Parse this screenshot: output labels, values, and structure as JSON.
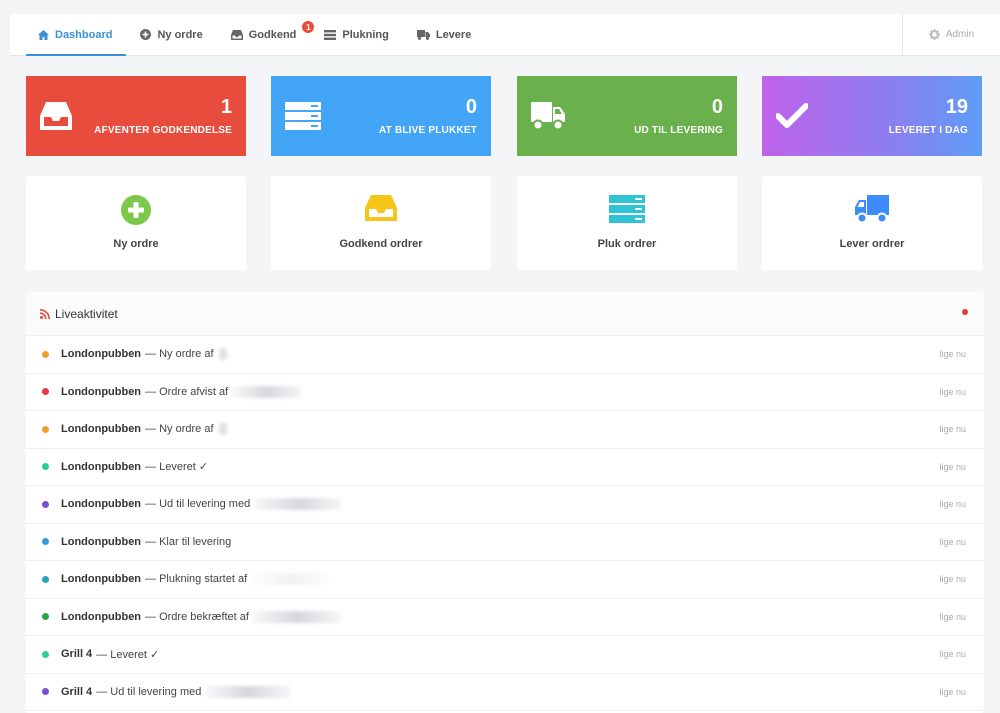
{
  "nav": {
    "tabs": [
      {
        "label": "Dashboard",
        "icon": "home-icon",
        "active": true
      },
      {
        "label": "Ny ordre",
        "icon": "plus-circle-icon"
      },
      {
        "label": "Godkend",
        "icon": "inbox-icon",
        "badge": "1"
      },
      {
        "label": "Plukning",
        "icon": "list-icon"
      },
      {
        "label": "Levere",
        "icon": "truck-icon"
      }
    ],
    "admin_label": "Admin",
    "admin_icon": "gear-icon"
  },
  "stats": [
    {
      "value": "1",
      "label": "AFVENTER GODKENDELSE",
      "icon": "inbox-icon",
      "color": "#e74c3c"
    },
    {
      "value": "0",
      "label": "AT BLIVE PLUKKET",
      "icon": "server-icon",
      "color": "#42a5f5"
    },
    {
      "value": "0",
      "label": "UD TIL LEVERING",
      "icon": "truck-icon",
      "color": "#6ab04c"
    },
    {
      "value": "19",
      "label": "LEVERET I DAG",
      "icon": "checkmark-icon",
      "color": "#b86bf0"
    }
  ],
  "actions": [
    {
      "label": "Ny ordre",
      "icon": "plus-circle-icon",
      "color": "#7cc84a"
    },
    {
      "label": "Godkend ordrer",
      "icon": "inbox-icon",
      "color": "#f5c518"
    },
    {
      "label": "Pluk ordrer",
      "icon": "server-icon",
      "color": "#2ec4d6"
    },
    {
      "label": "Lever ordrer",
      "icon": "truck-icon",
      "color": "#3d8bfd"
    }
  ],
  "live": {
    "title": "Liveaktivitet",
    "icon": "rss-icon",
    "items": [
      {
        "name": "Londonpubben",
        "text": "— Ny ordre af",
        "time": "lige nu",
        "color": "#f0a030"
      },
      {
        "name": "Londonpubben",
        "text": "— Ordre afvist af",
        "time": "lige nu",
        "color": "#e03a4a"
      },
      {
        "name": "Londonpubben",
        "text": "— Ny ordre af",
        "time": "lige nu",
        "color": "#f0a030"
      },
      {
        "name": "Londonpubben",
        "text": "— Leveret ✓",
        "time": "lige nu",
        "color": "#2ecc9a"
      },
      {
        "name": "Londonpubben",
        "text": "— Ud til levering med",
        "time": "lige nu",
        "color": "#7a4fd0"
      },
      {
        "name": "Londonpubben",
        "text": "— Klar til levering",
        "time": "lige nu",
        "color": "#3a9ad9"
      },
      {
        "name": "Londonpubben",
        "text": "— Plukning startet af",
        "time": "lige nu",
        "color": "#27a3b8"
      },
      {
        "name": "Londonpubben",
        "text": "— Ordre bekræftet af",
        "time": "lige nu",
        "color": "#28a745"
      },
      {
        "name": "Grill 4",
        "text": "— Leveret ✓",
        "time": "lige nu",
        "color": "#2ecc9a"
      },
      {
        "name": "Grill 4",
        "text": "— Ud til levering med",
        "time": "lige nu",
        "color": "#7a4fd0"
      }
    ]
  }
}
